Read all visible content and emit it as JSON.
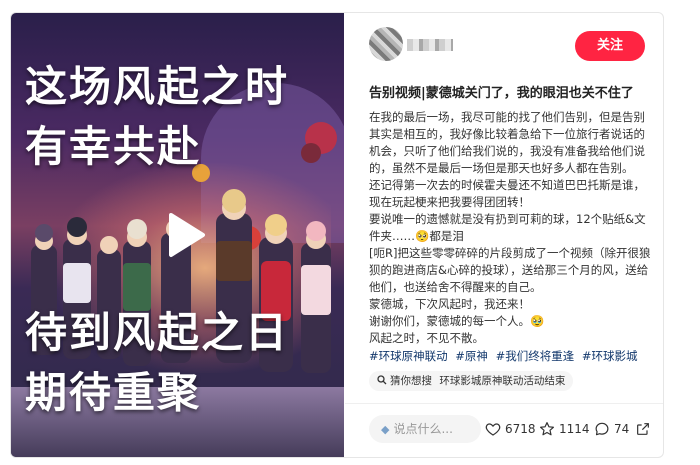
{
  "video": {
    "overlay_line1": "这场风起之时",
    "overlay_line2": "有幸共赴",
    "overlay_line3": "待到风起之日",
    "overlay_line4": "期待重聚"
  },
  "header": {
    "follow_label": "关注"
  },
  "post": {
    "title": "告别视频|蒙德城关门了，我的眼泪也关不住了",
    "paragraphs": [
      "在我的最后一场，我尽可能的找了他们告别，但是告别其实是相互的，我好像比较着急给下一位旅行者说话的机会，只听了他们给我们说的，我没有准备我给他们说的，虽然不是最后一场但是那天也好多人都在告别。",
      "还记得第一次去的时候霍夫曼还不知道巴巴托斯是谁，现在玩起梗来把我要得团团转！",
      "要说唯一的遗憾就是没有扔到可莉的球，12个贴纸&文件夹……🥺都是泪",
      "[呃R]把这些零零碎碎的片段剪成了一个视频（除开很狼狈的跑进商店&心碎的投球），送给那三个月的风，送给他们，也送给舍不得醒来的自己。",
      "蒙德城，下次风起时，我还来！",
      "谢谢你们，蒙德城的每一个人。🥹",
      "风起之时，不见不散。"
    ],
    "tags": [
      "#环球原神联动",
      "#原神",
      "#我们终将重逢",
      "#环球影城"
    ],
    "search_suggestion": {
      "prefix": "猜你想搜",
      "query": "环球影城原神联动活动结束"
    }
  },
  "footer": {
    "comment_placeholder": "说点什么...",
    "likes": "6718",
    "favorites": "1114",
    "comments": "74"
  },
  "colors": {
    "accent": "#ff2442",
    "tag": "#13386c"
  },
  "icons": [
    "play-icon",
    "pen-icon",
    "heart-icon",
    "star-icon",
    "comment-icon",
    "share-icon",
    "search-icon"
  ]
}
